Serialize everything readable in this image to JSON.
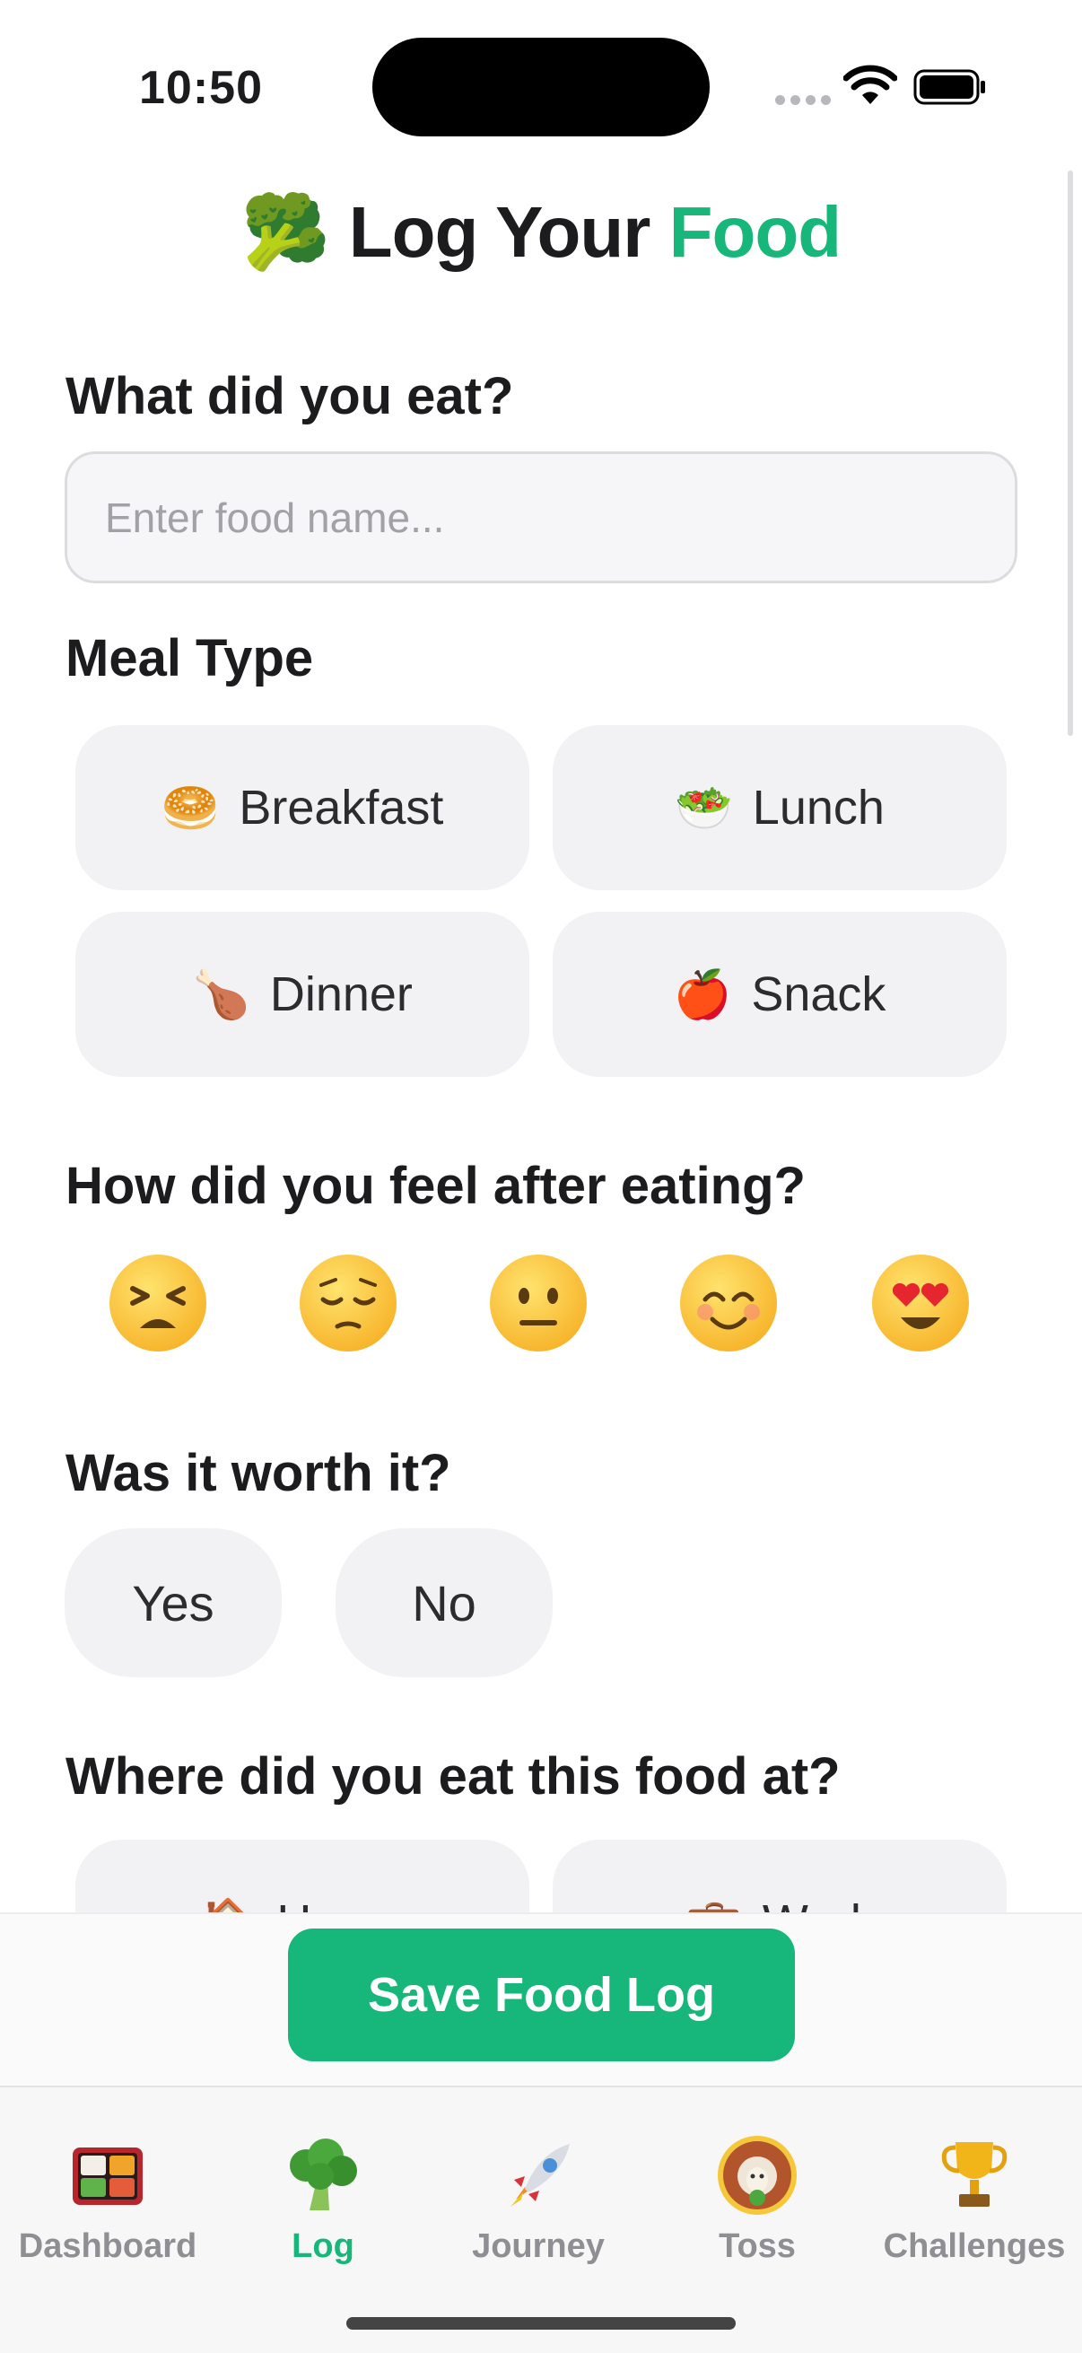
{
  "status_bar": {
    "time": "10:50"
  },
  "header": {
    "title_prefix": "Log Your",
    "title_accent": "Food",
    "title_emoji": "🥦"
  },
  "food": {
    "label": "What did you eat?",
    "placeholder": "Enter food name...",
    "value": ""
  },
  "meal_type": {
    "label": "Meal Type",
    "options": [
      {
        "emoji": "🥯",
        "label": "Breakfast"
      },
      {
        "emoji": "🥗",
        "label": "Lunch"
      },
      {
        "emoji": "🍗",
        "label": "Dinner"
      },
      {
        "emoji": "🍎",
        "label": "Snack"
      }
    ]
  },
  "feeling": {
    "label": "How did you feel after eating?",
    "options": [
      "tired-face",
      "pensive-face",
      "neutral-face",
      "smiling-face",
      "heart-eyes-face"
    ]
  },
  "worth": {
    "label": "Was it worth it?",
    "yes": "Yes",
    "no": "No"
  },
  "location": {
    "label": "Where did you eat this food at?",
    "options": [
      {
        "emoji": "🏠",
        "label": "Home"
      },
      {
        "emoji": "💼",
        "label": "Work"
      }
    ]
  },
  "save_button": "Save Food Log",
  "tabs": [
    {
      "label": "Dashboard",
      "icon": "bento-box-icon",
      "active": false
    },
    {
      "label": "Log",
      "icon": "broccoli-icon",
      "active": true
    },
    {
      "label": "Journey",
      "icon": "rocket-icon",
      "active": false
    },
    {
      "label": "Toss",
      "icon": "sheep-avatar-icon",
      "active": false
    },
    {
      "label": "Challenges",
      "icon": "trophy-icon",
      "active": false
    }
  ],
  "colors": {
    "accent": "#17b67a",
    "chip_bg": "#f2f2f5",
    "text": "#1c1c1e",
    "muted": "#8e8e93"
  }
}
